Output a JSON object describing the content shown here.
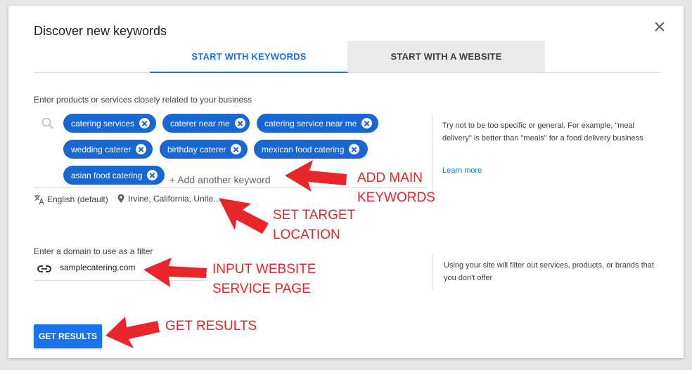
{
  "dialog": {
    "title": "Discover new keywords",
    "tabs": [
      {
        "label": "START WITH KEYWORDS",
        "active": true
      },
      {
        "label": "START WITH A WEBSITE",
        "active": false
      }
    ]
  },
  "keywords": {
    "label": "Enter products or services closely related to your business",
    "chips": [
      "catering services",
      "caterer near me",
      "catering service near me",
      "wedding caterer",
      "birthday caterer",
      "mexican food catering",
      "asian food catering"
    ],
    "add_placeholder": "+ Add another keyword",
    "language": "English (default)",
    "location": "Irvine, California, Unite...",
    "help_text": "Try not to be too specific or general. For example, \"meal delivery\" is better than \"meals\" for a food delivery business",
    "learn_more": "Learn more"
  },
  "domain": {
    "label": "Enter a domain to use as a filter",
    "value": "samplecatering.com",
    "help_text": "Using your site will filter out services, products, or brands that you don't offer"
  },
  "get_results_label": "GET RESULTS",
  "annotations": {
    "add_main_keywords": [
      "ADD MAIN",
      "KEYWORDS"
    ],
    "set_target_location": [
      "SET TARGET",
      "LOCATION"
    ],
    "input_website": [
      "INPUT WEBSITE",
      "SERVICE PAGE"
    ],
    "get_results": "GET RESULTS"
  },
  "colors": {
    "accent": "#1a73e8",
    "chip": "#1967d2",
    "annotation": "#e8252a"
  }
}
